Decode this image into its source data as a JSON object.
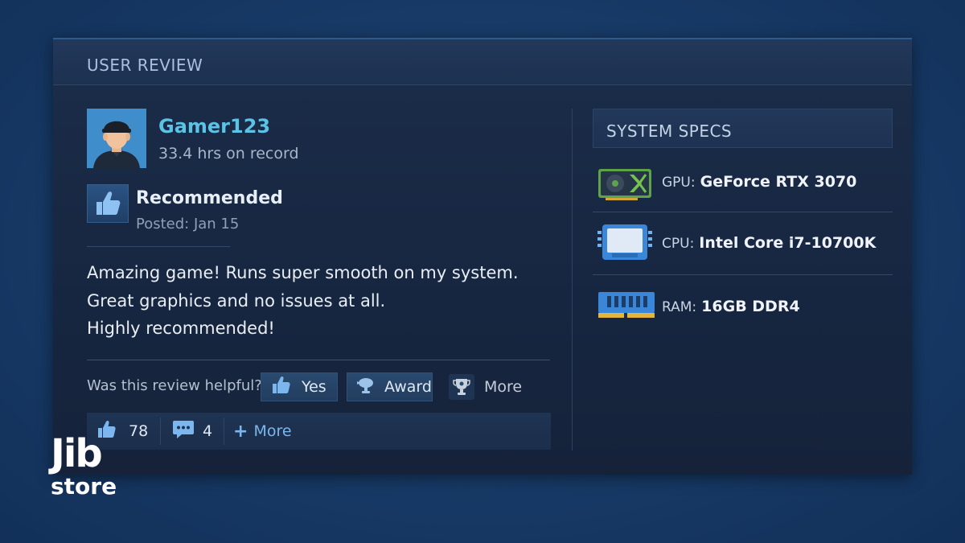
{
  "card": {
    "title": "USER REVIEW"
  },
  "reviewer": {
    "username": "Gamer123",
    "playtime": "33.4 hrs on record"
  },
  "recommendation": {
    "label": "Recommended",
    "posted": "Posted: Jan 15"
  },
  "review": {
    "lines": [
      "Amazing game! Runs super smooth on my system.",
      "Great graphics and no issues at all.",
      "Highly recommended!"
    ]
  },
  "helpful": {
    "question": "Was this review helpful?",
    "yes_label": "Yes",
    "award_label": "Award",
    "more_label": "More"
  },
  "stats": {
    "likes": "78",
    "comments": "4",
    "more_label": "More"
  },
  "specs": {
    "title": "SYSTEM SPECS",
    "items": [
      {
        "label": "GPU:",
        "value": "GeForce RTX 3070",
        "icon": "gpu-icon"
      },
      {
        "label": "CPU:",
        "value": "Intel Core i7-10700K",
        "icon": "cpu-icon"
      },
      {
        "label": "RAM:",
        "value": "16GB DDR4",
        "icon": "ram-icon"
      }
    ]
  },
  "logo": {
    "line1": "Jib",
    "line2": "store"
  },
  "colors": {
    "accent": "#5cc3e6",
    "thumb": "#7cb6ee",
    "panel": "#172640",
    "background": "#173a66"
  }
}
